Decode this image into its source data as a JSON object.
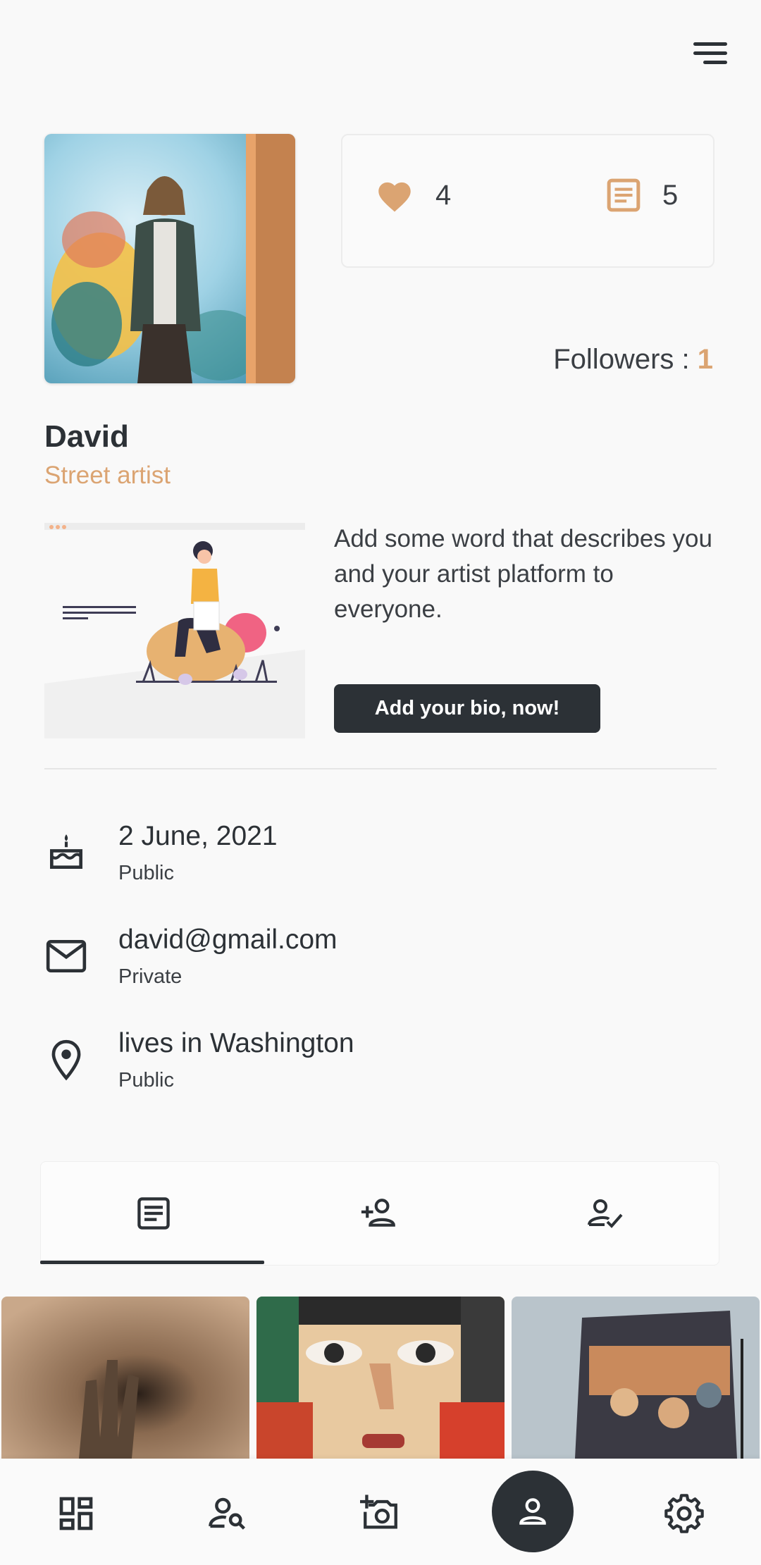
{
  "header": {
    "menu_icon": "hamburger-menu-icon"
  },
  "profile": {
    "name": "David",
    "role": "Street artist",
    "followers_label": "Followers :",
    "followers_count": "1"
  },
  "stats": {
    "likes_icon": "heart-icon",
    "likes": "4",
    "posts_icon": "article-icon",
    "posts": "5"
  },
  "bio": {
    "prompt": "Add some word that describes you and your artist platform to everyone.",
    "button_label": "Add your bio, now!"
  },
  "info": [
    {
      "icon": "cake-icon",
      "value": "2 June, 2021",
      "visibility": "Public"
    },
    {
      "icon": "mail-icon",
      "value": "david@gmail.com",
      "visibility": "Private"
    },
    {
      "icon": "location-pin-icon",
      "value": "lives in Washington",
      "visibility": "Public"
    }
  ],
  "tabs": [
    {
      "icon": "article-icon",
      "active": true
    },
    {
      "icon": "person-add-icon",
      "active": false
    },
    {
      "icon": "person-check-icon",
      "active": false
    }
  ],
  "bottom_nav": [
    {
      "icon": "dashboard-icon",
      "active": false
    },
    {
      "icon": "person-search-icon",
      "active": false
    },
    {
      "icon": "add-photo-icon",
      "active": false
    },
    {
      "icon": "profile-icon",
      "active": true
    },
    {
      "icon": "settings-gear-icon",
      "active": false
    }
  ],
  "colors": {
    "accent": "#dba472",
    "dark": "#2c3136",
    "background": "#f9f9f9"
  }
}
